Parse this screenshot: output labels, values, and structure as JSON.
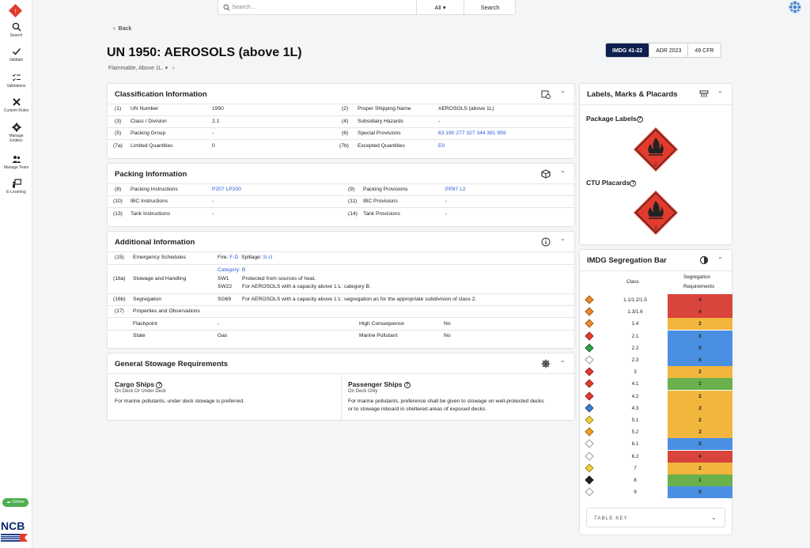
{
  "nav": {
    "items": [
      {
        "label": "Search",
        "icon": "search-icon"
      },
      {
        "label": "Validate",
        "icon": "check-icon"
      },
      {
        "label": "Validations",
        "icon": "checklist-icon"
      },
      {
        "label": "Custom Rules",
        "icon": "tools-icon"
      },
      {
        "label": "Manage Entities",
        "icon": "gear-icon"
      },
      {
        "label": "Manage Team",
        "icon": "team-icon"
      },
      {
        "label": "E-Learning",
        "icon": "elearning-icon"
      }
    ],
    "online": "Online",
    "brand": "NCB"
  },
  "search": {
    "placeholder": "Search...",
    "scope": "All",
    "button": "Search"
  },
  "page": {
    "back": "Back",
    "title": "UN 1950: AEROSOLS (above 1L)",
    "subtitle": "Flammable, Above 1L.",
    "regs": [
      "IMDG 41-22",
      "ADR 2023",
      "49 CFR"
    ],
    "active_reg": "IMDG 41-22"
  },
  "classification": {
    "title": "Classification Information",
    "rows": [
      {
        "n1": "(1)",
        "l1": "UN Number",
        "v1": "1950",
        "n2": "(2)",
        "l2": "Proper Shipping Name",
        "v2": "AEROSOLS (above 1L)"
      },
      {
        "n1": "(3)",
        "l1": "Class / Division",
        "v1": "2.1",
        "n2": "(4)",
        "l2": "Subsidiary Hazards",
        "v2": "-"
      },
      {
        "n1": "(5)",
        "l1": "Packing Group",
        "v1": "-",
        "n2": "(6)",
        "l2": "Special Provisions",
        "v2": "63 190 277 327 344 381 959"
      },
      {
        "n1": "(7a)",
        "l1": "Limited Quantities",
        "v1": "0",
        "n2": "(7b)",
        "l2": "Excepted Quantities",
        "v2": "E0"
      }
    ]
  },
  "packing": {
    "title": "Packing Information",
    "rows": [
      {
        "n1": "(8)",
        "l1": "Packing Instructions",
        "v1": "P207 LP200",
        "n2": "(9)",
        "l2": "Packing Provisions",
        "v2": "PP87 L2"
      },
      {
        "n1": "(10)",
        "l1": "IBC Instructions",
        "v1": "-",
        "n2": "(11)",
        "l2": "IBC Provisions",
        "v2": "-"
      },
      {
        "n1": "(13)",
        "l1": "Tank Instructions",
        "v1": "-",
        "n2": "(14)",
        "l2": "Tank Provisions",
        "v2": "-"
      }
    ]
  },
  "additional": {
    "title": "Additional Information",
    "ems": {
      "n": "(15)",
      "label": "Emergency Schedules",
      "fire_label": "Fire:",
      "fire": "F-D",
      "spill_label": "Spillage:",
      "spill": "S-U"
    },
    "stowage": {
      "n": "(16a)",
      "label": "Stowage and Handling",
      "category": "Category: B",
      "codes": [
        {
          "code": "SW1",
          "text": "Protected from sources of heat."
        },
        {
          "code": "SW22",
          "text": "For AEROSOLS with a capacity above 1 L: category B."
        }
      ]
    },
    "segregation": {
      "n": "(16b)",
      "label": "Segregation",
      "code": "SG69",
      "text": "For AEROSOLS with a capacity above 1 L: segregation as for the appropriate subdivision of class 2."
    },
    "properties": {
      "n": "(17)",
      "label": "Properties and Observations"
    },
    "props": [
      {
        "l1": "Flashpoint",
        "v1": "-",
        "l2": "High Consequence",
        "v2": "No"
      },
      {
        "l1": "State",
        "v1": "Gas",
        "l2": "Marine Pollutant",
        "v2": "No"
      }
    ]
  },
  "stowage_general": {
    "title": "General Stowage Requirements",
    "cargo": {
      "title": "Cargo Ships",
      "sub": "On Deck Or Under Deck",
      "text": "For marine pollutants, under deck stowage is preferred."
    },
    "passenger": {
      "title": "Passenger Ships",
      "sub": "On Deck Only",
      "text1": "For marine pollutants, preference shall be given to stowage on well-protected decks",
      "text2": "or to stowage inboard in sheltered areas of exposed decks."
    }
  },
  "labels": {
    "title": "Labels, Marks & Placards",
    "package": "Package Labels",
    "ctu": "CTU Placards"
  },
  "segbar": {
    "title": "IMDG Segregation Bar",
    "col_class": "Class",
    "col_req1": "Segregation",
    "col_req2": "Requirements",
    "table_key": "TABLE KEY",
    "colors": {
      "red": "#d9443d",
      "yellow": "#f2b63c",
      "blue": "#4a90e2",
      "green": "#6ab04c"
    },
    "rows": [
      {
        "cls": "1.1/1.2/1.5",
        "req": "4",
        "color": "red",
        "dia": "#f08a2a"
      },
      {
        "cls": "1.3/1.6",
        "req": "4",
        "color": "red",
        "dia": "#f08a2a"
      },
      {
        "cls": "1.4",
        "req": "2",
        "color": "yellow",
        "dia": "#f08a2a"
      },
      {
        "cls": "2.1",
        "req": "X",
        "color": "blue",
        "dia": "#e23b2e"
      },
      {
        "cls": "2.2",
        "req": "X",
        "color": "blue",
        "dia": "#2f9e44"
      },
      {
        "cls": "2.3",
        "req": "X",
        "color": "blue",
        "dia": "#ffffff"
      },
      {
        "cls": "3",
        "req": "2",
        "color": "yellow",
        "dia": "#e23b2e"
      },
      {
        "cls": "4.1",
        "req": "1",
        "color": "green",
        "dia": "#e23b2e"
      },
      {
        "cls": "4.2",
        "req": "2",
        "color": "yellow",
        "dia": "#e23b2e"
      },
      {
        "cls": "4.3",
        "req": "2",
        "color": "yellow",
        "dia": "#3a7bd5"
      },
      {
        "cls": "5.1",
        "req": "2",
        "color": "yellow",
        "dia": "#f4d03f"
      },
      {
        "cls": "5.2",
        "req": "2",
        "color": "yellow",
        "dia": "#f4a020"
      },
      {
        "cls": "6.1",
        "req": "X",
        "color": "blue",
        "dia": "#ffffff"
      },
      {
        "cls": "6.2",
        "req": "4",
        "color": "red",
        "dia": "#ffffff"
      },
      {
        "cls": "7",
        "req": "2",
        "color": "yellow",
        "dia": "#f4d03f"
      },
      {
        "cls": "8",
        "req": "1",
        "color": "green",
        "dia": "#222222"
      },
      {
        "cls": "9",
        "req": "X",
        "color": "blue",
        "dia": "#ffffff"
      }
    ]
  }
}
